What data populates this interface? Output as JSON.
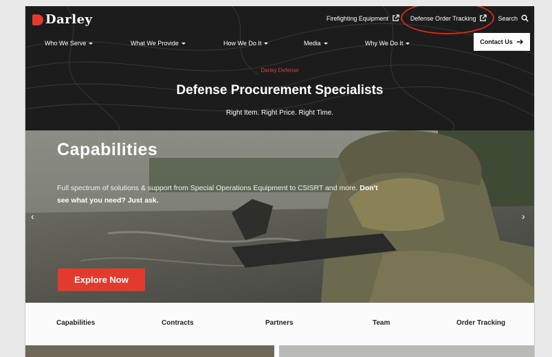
{
  "brand": {
    "name": "Darley",
    "accent": "#e23b2e"
  },
  "utility_nav": [
    {
      "label": "Firefighting Equipment",
      "icon": "external-link-icon"
    },
    {
      "label": "Defense Order Tracking",
      "icon": "external-link-icon"
    },
    {
      "label": "Search",
      "icon": "search-icon"
    }
  ],
  "main_nav": [
    {
      "label": "Who We Serve"
    },
    {
      "label": "What We Provide"
    },
    {
      "label": "How We Do It"
    },
    {
      "label": "Media"
    },
    {
      "label": "Why We Do It"
    }
  ],
  "contact_button": {
    "label": "Contact Us",
    "icon": "arrow-right-icon"
  },
  "intro": {
    "eyebrow": "Darley Defense",
    "headline": "Defense Procurement Specialists",
    "tagline": "Right Item. Right Price. Right Time."
  },
  "hero": {
    "title": "Capabilities",
    "body": "Full spectrum of solutions & support from Special Operations Equipment to C5ISRT and more.",
    "body_bold": "Don't see what you need? Just ask.",
    "cta": "Explore Now",
    "prev_icon": "chevron-left-icon",
    "next_icon": "chevron-right-icon"
  },
  "tabs": [
    "Capabilities",
    "Contracts",
    "Partners",
    "Team",
    "Order Tracking"
  ],
  "annotation": {
    "color": "#d6281e"
  }
}
